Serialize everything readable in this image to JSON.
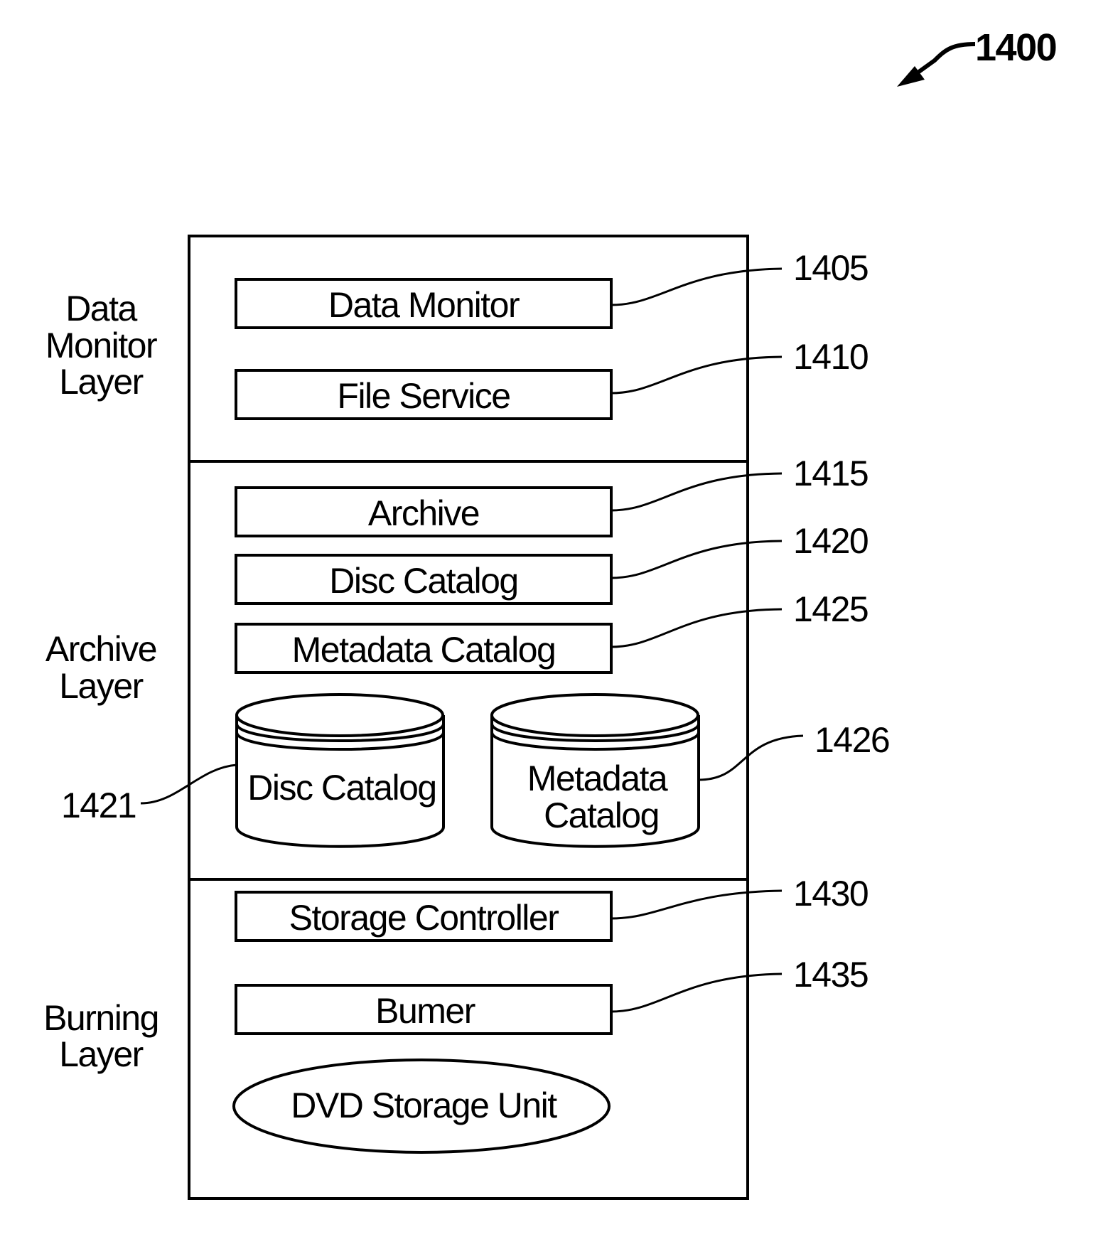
{
  "figure": {
    "number": "1400"
  },
  "layers": [
    {
      "id": "data-monitor",
      "label_lines": [
        "Data",
        "Monitor",
        "Layer"
      ]
    },
    {
      "id": "archive",
      "label_lines": [
        "Archive",
        "Layer"
      ]
    },
    {
      "id": "burning",
      "label_lines": [
        "Burning",
        "Layer"
      ]
    }
  ],
  "components": {
    "data_monitor": {
      "label": "Data Monitor",
      "ref": "1405"
    },
    "file_service": {
      "label": "File Service",
      "ref": "1410"
    },
    "archive": {
      "label": "Archive",
      "ref": "1415"
    },
    "disc_catalog": {
      "label": "Disc Catalog",
      "ref": "1420"
    },
    "metadata_catalog": {
      "label": "Metadata Catalog",
      "ref": "1425"
    },
    "disc_catalog_db": {
      "label": "Disc Catalog",
      "ref": "1421"
    },
    "metadata_catalog_db": {
      "label_lines": [
        "Metadata",
        "Catalog"
      ],
      "ref": "1426"
    },
    "storage_controller": {
      "label": "Storage Controller",
      "ref": "1430"
    },
    "burner": {
      "label": "Bumer",
      "ref": "1435"
    },
    "dvd_storage_unit": {
      "label": "DVD Storage Unit"
    }
  }
}
